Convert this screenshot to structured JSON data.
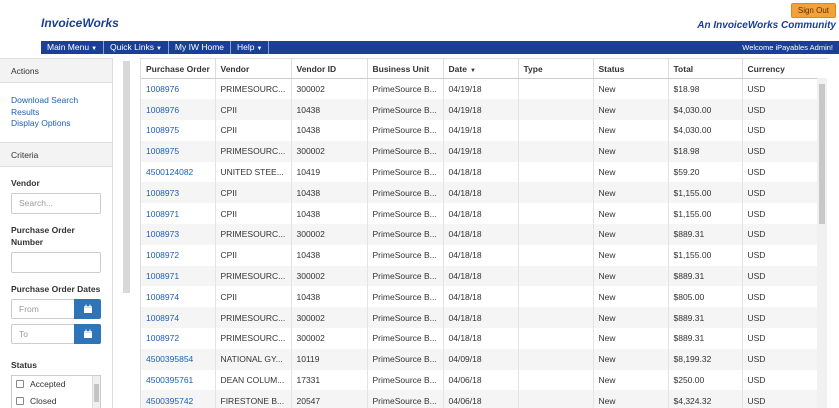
{
  "header": {
    "brand": "InvoiceWorks",
    "signout_label": "Sign Out",
    "community": "An InvoiceWorks Community"
  },
  "nav": {
    "items": [
      {
        "label": "Main Menu",
        "dropdown": true
      },
      {
        "label": "Quick Links",
        "dropdown": true
      },
      {
        "label": "My IW Home",
        "dropdown": false
      },
      {
        "label": "Help",
        "dropdown": true
      }
    ],
    "welcome": "Welcome iPayables Admin!"
  },
  "sidebar": {
    "actions_title": "Actions",
    "links": [
      "Download Search Results",
      "Display Options"
    ],
    "criteria_title": "Criteria",
    "vendor_label": "Vendor",
    "vendor_placeholder": "Search...",
    "po_label": "Purchase Order Number",
    "po_value": "",
    "dates_label": "Purchase Order Dates",
    "from_placeholder": "From",
    "to_placeholder": "To",
    "status_label": "Status",
    "status_options": [
      "Accepted",
      "Closed"
    ]
  },
  "table": {
    "columns": [
      "Purchase Order",
      "Vendor",
      "Vendor ID",
      "Business Unit",
      "Date",
      "Type",
      "Status",
      "Total",
      "Currency"
    ],
    "sorted_column": "Date",
    "rows": [
      [
        "1008976",
        "PRIMESOURC...",
        "300002",
        "PrimeSource B...",
        "04/19/18",
        "",
        "New",
        "$18.98",
        "USD"
      ],
      [
        "1008976",
        "CPII",
        "10438",
        "PrimeSource B...",
        "04/19/18",
        "",
        "New",
        "$4,030.00",
        "USD"
      ],
      [
        "1008975",
        "CPII",
        "10438",
        "PrimeSource B...",
        "04/19/18",
        "",
        "New",
        "$4,030.00",
        "USD"
      ],
      [
        "1008975",
        "PRIMESOURC...",
        "300002",
        "PrimeSource B...",
        "04/19/18",
        "",
        "New",
        "$18.98",
        "USD"
      ],
      [
        "4500124082",
        "UNITED STEE...",
        "10419",
        "PrimeSource B...",
        "04/18/18",
        "",
        "New",
        "$59.20",
        "USD"
      ],
      [
        "1008973",
        "CPII",
        "10438",
        "PrimeSource B...",
        "04/18/18",
        "",
        "New",
        "$1,155.00",
        "USD"
      ],
      [
        "1008971",
        "CPII",
        "10438",
        "PrimeSource B...",
        "04/18/18",
        "",
        "New",
        "$1,155.00",
        "USD"
      ],
      [
        "1008973",
        "PRIMESOURC...",
        "300002",
        "PrimeSource B...",
        "04/18/18",
        "",
        "New",
        "$889.31",
        "USD"
      ],
      [
        "1008972",
        "CPII",
        "10438",
        "PrimeSource B...",
        "04/18/18",
        "",
        "New",
        "$1,155.00",
        "USD"
      ],
      [
        "1008971",
        "PRIMESOURC...",
        "300002",
        "PrimeSource B...",
        "04/18/18",
        "",
        "New",
        "$889.31",
        "USD"
      ],
      [
        "1008974",
        "CPII",
        "10438",
        "PrimeSource B...",
        "04/18/18",
        "",
        "New",
        "$805.00",
        "USD"
      ],
      [
        "1008974",
        "PRIMESOURC...",
        "300002",
        "PrimeSource B...",
        "04/18/18",
        "",
        "New",
        "$889.31",
        "USD"
      ],
      [
        "1008972",
        "PRIMESOURC...",
        "300002",
        "PrimeSource B...",
        "04/18/18",
        "",
        "New",
        "$889.31",
        "USD"
      ],
      [
        "4500395854",
        "NATIONAL GY...",
        "10119",
        "PrimeSource B...",
        "04/09/18",
        "",
        "New",
        "$8,199.32",
        "USD"
      ],
      [
        "4500395761",
        "DEAN COLUM...",
        "17331",
        "PrimeSource B...",
        "04/06/18",
        "",
        "New",
        "$250.00",
        "USD"
      ],
      [
        "4500395742",
        "FIRESTONE B...",
        "20547",
        "PrimeSource B...",
        "04/06/18",
        "",
        "New",
        "$4,324.32",
        "USD"
      ]
    ]
  },
  "colors": {
    "brand_blue": "#1c3f95",
    "link_blue": "#1c5fb5",
    "signout_orange": "#f3a23a",
    "calendar_button": "#2f74b7"
  },
  "icons": {
    "calendar": "calendar-icon",
    "caret": "chevron-down-icon",
    "sort": "sort-desc-icon"
  }
}
